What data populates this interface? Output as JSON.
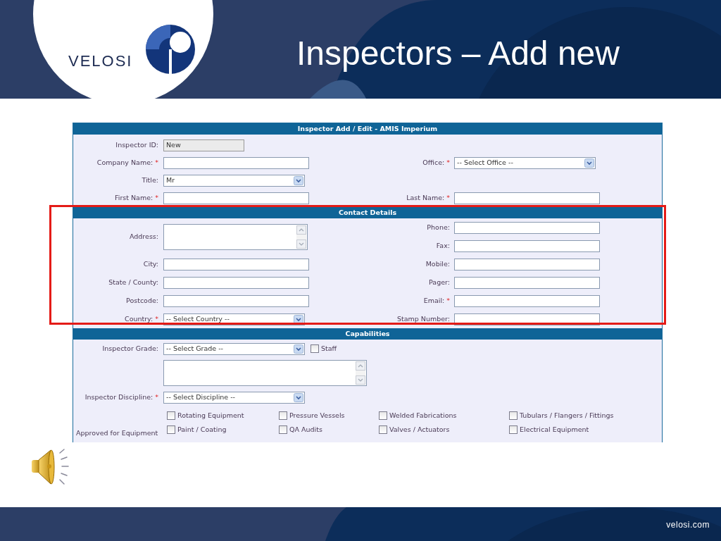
{
  "slide": {
    "logo_text": "VELOSI",
    "title": "Inspectors – Add new",
    "footer_text": "velosi.com",
    "highlighted": true
  },
  "form": {
    "title": "Inspector Add / Edit - AMIS Imperium",
    "sections": [
      {
        "kind": "general",
        "rows": [
          {
            "left": {
              "label": "Inspector ID:",
              "kind": "readonly",
              "value": "New"
            }
          },
          {
            "left": {
              "label": "Company Name:",
              "kind": "text",
              "required_mark": "*"
            },
            "right": {
              "label": "Office:",
              "kind": "select",
              "value": "-- Select Office --",
              "required_mark": "*"
            }
          },
          {
            "left": {
              "label": "Title:",
              "kind": "select",
              "value": "Mr"
            }
          },
          {
            "left": {
              "label": "First Name:",
              "kind": "text",
              "required_mark": "*"
            },
            "right": {
              "label": "Last Name:",
              "kind": "text",
              "required_mark": "*"
            }
          }
        ]
      },
      {
        "kind": "contact",
        "heading": "Contact Details",
        "rows": [
          {
            "left": {
              "label": "Address:",
              "kind": "textarea"
            },
            "right": [
              {
                "label": "Phone:",
                "kind": "text"
              },
              {
                "label": "Fax:",
                "kind": "text"
              }
            ]
          },
          {
            "left": {
              "label": "City:",
              "kind": "text"
            },
            "right": {
              "label": "Mobile:",
              "kind": "text"
            }
          },
          {
            "left": {
              "label": "State / County:",
              "kind": "text"
            },
            "right": {
              "label": "Pager:",
              "kind": "text"
            }
          },
          {
            "left": {
              "label": "Postcode:",
              "kind": "text"
            },
            "right": {
              "label": "Email:",
              "kind": "text",
              "required_mark": "*"
            }
          },
          {
            "left": {
              "label": "Country:",
              "kind": "select",
              "value": "-- Select Country --",
              "required_mark": "*"
            },
            "right": {
              "label": "Stamp Number:",
              "kind": "text"
            }
          }
        ]
      },
      {
        "kind": "capabilities",
        "heading": "Capabilities",
        "rows": [
          {
            "left": {
              "label": "Inspector Grade:",
              "kind": "select",
              "value": "-- Select Grade --"
            },
            "checkbox": {
              "label": "Staff",
              "checked": false
            }
          },
          {
            "left": {
              "kind": "notes"
            }
          },
          {
            "left": {
              "label": "Inspector Discipline:",
              "kind": "select",
              "value": "-- Select Discipline --",
              "required_mark": "*"
            }
          }
        ],
        "equipment": {
          "label": "Approved for Equipment",
          "options": [
            {
              "label": "Rotating Equipment",
              "checked": false
            },
            {
              "label": "Pressure Vessels",
              "checked": false
            },
            {
              "label": "Welded Fabrications",
              "checked": false
            },
            {
              "label": "Tubulars / Flangers / Fittings",
              "checked": false
            },
            {
              "label": "Paint / Coating",
              "checked": false
            },
            {
              "label": "QA Audits",
              "checked": false
            },
            {
              "label": "Valves / Actuators",
              "checked": false
            },
            {
              "label": "Electrical Equipment",
              "checked": false
            }
          ]
        }
      }
    ]
  }
}
